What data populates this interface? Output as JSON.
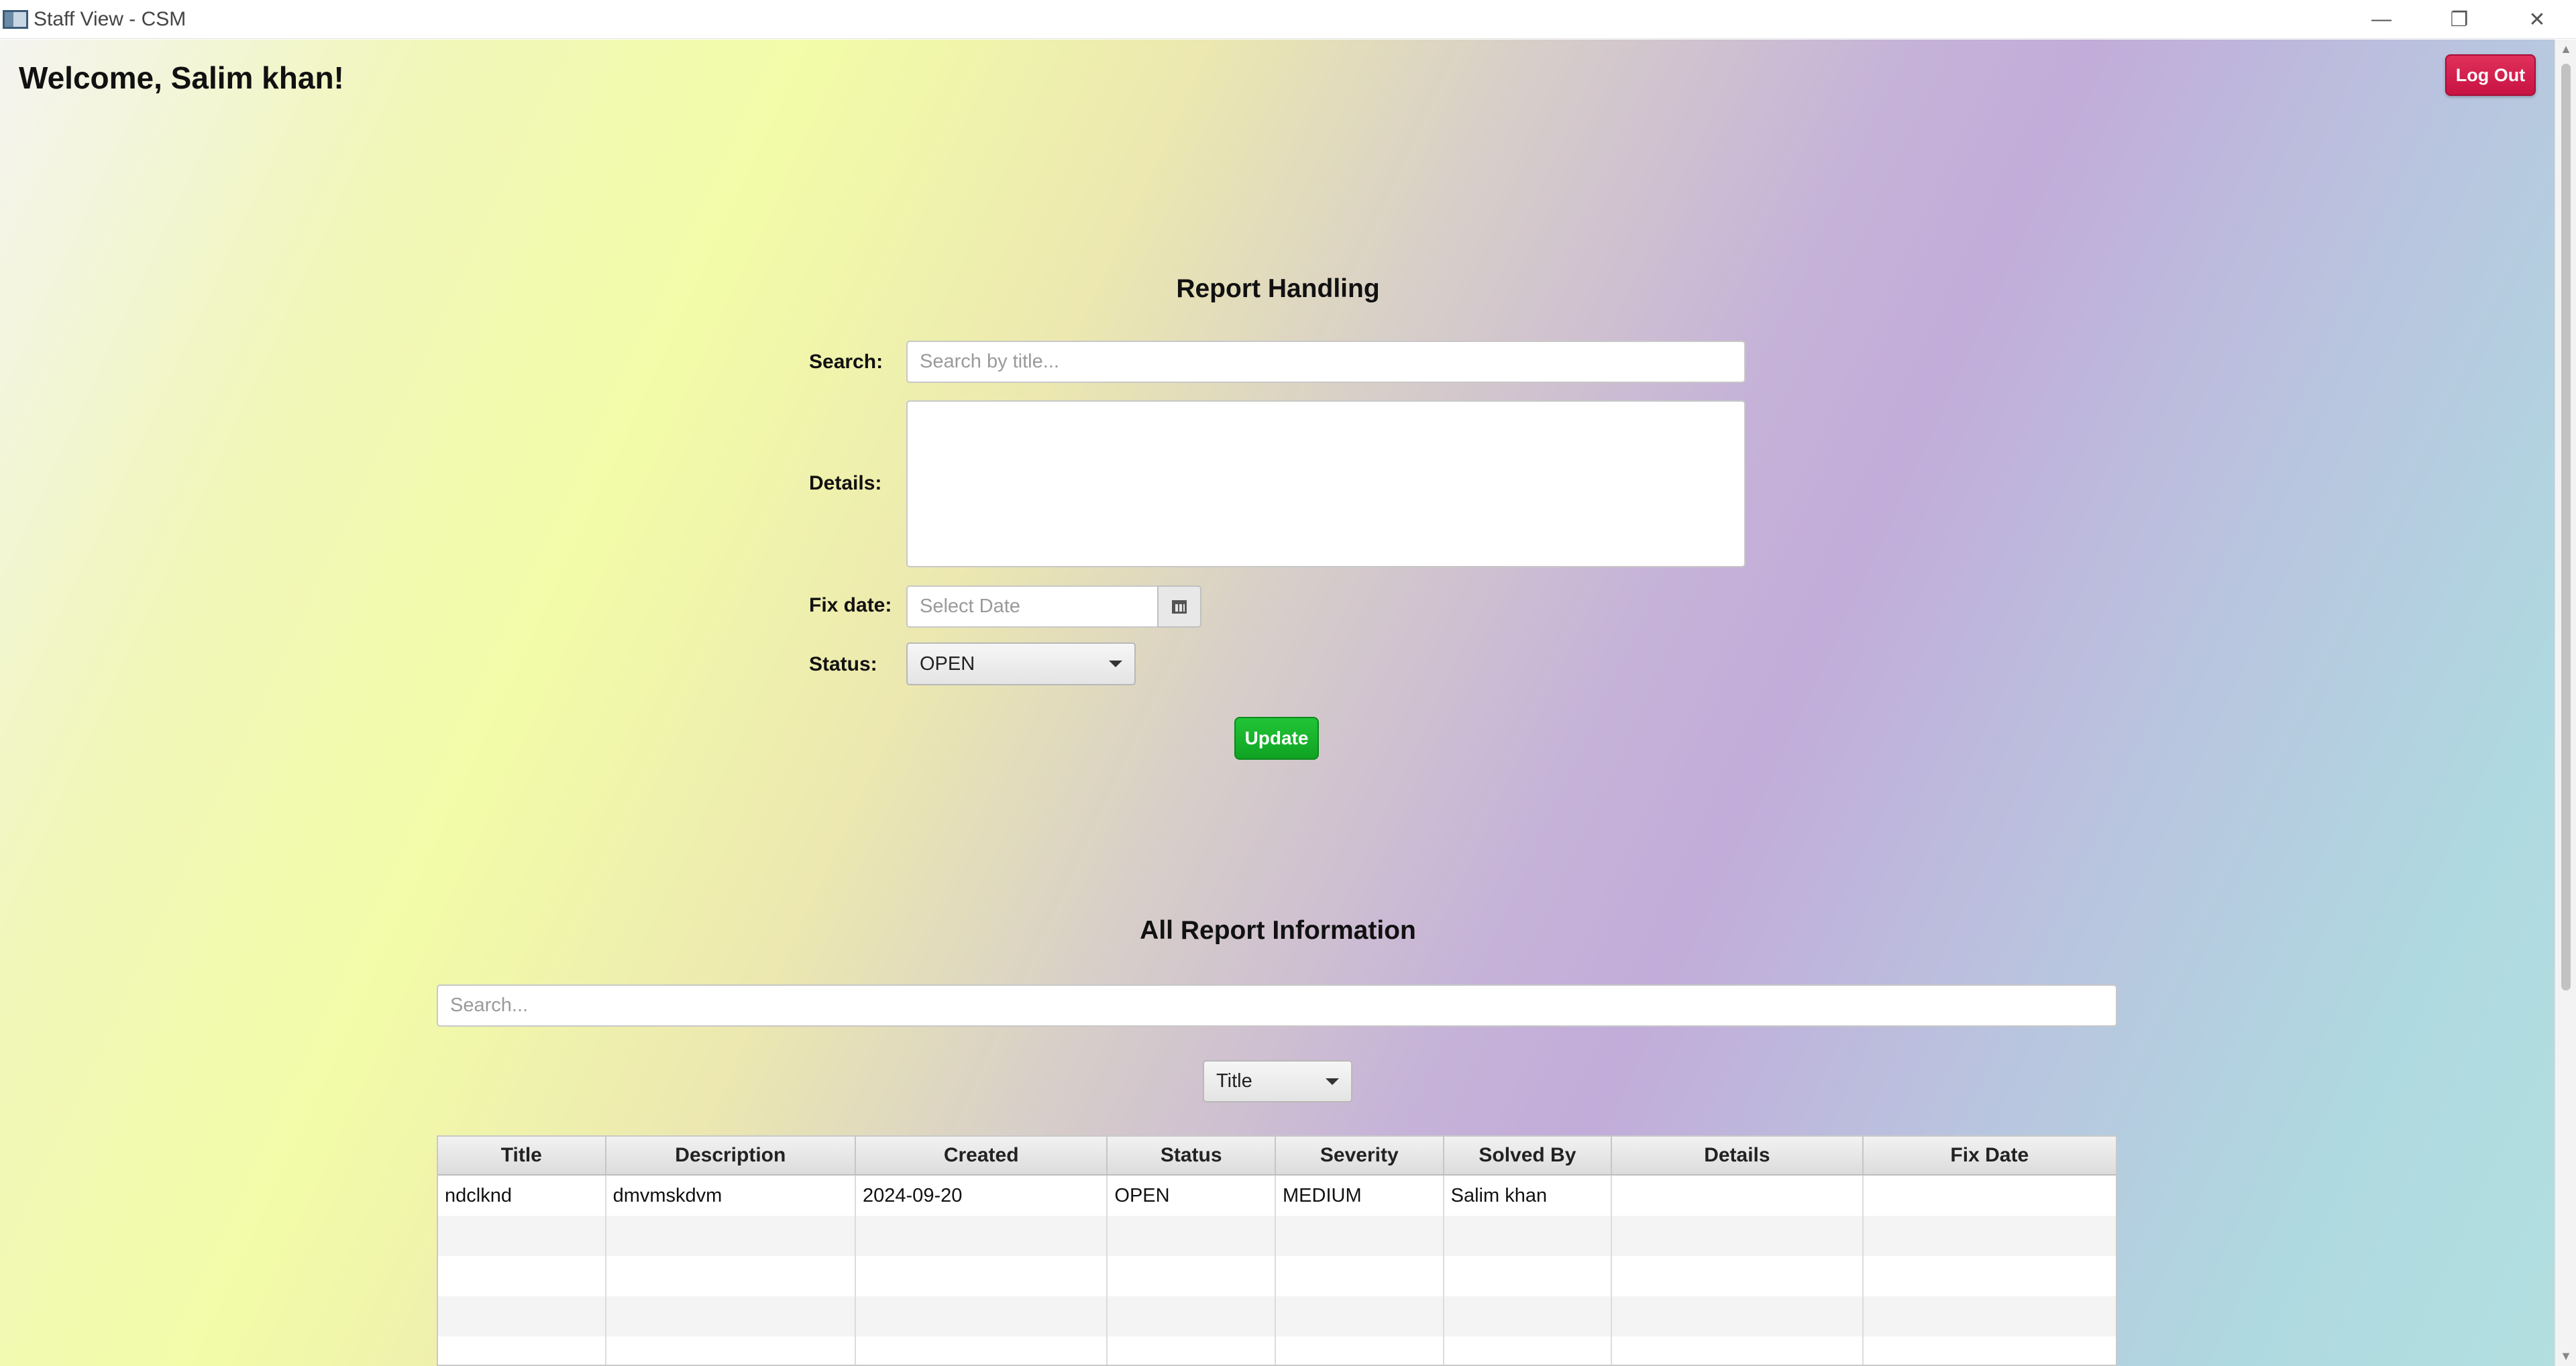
{
  "window": {
    "title": "Staff View - CSM",
    "minimize_glyph": "—",
    "maximize_glyph": "❐",
    "close_glyph": "✕"
  },
  "header": {
    "welcome": "Welcome, Salim khan!",
    "logout_label": "Log Out"
  },
  "report_handling": {
    "title": "Report Handling",
    "search_label": "Search:",
    "search_placeholder": "Search by title...",
    "details_label": "Details:",
    "details_value": "",
    "fix_date_label": "Fix date:",
    "fix_date_placeholder": "Select Date",
    "status_label": "Status:",
    "status_value": "OPEN",
    "update_label": "Update"
  },
  "all_reports": {
    "title": "All Report Information",
    "search_placeholder": "Search...",
    "filter_value": "Title",
    "columns": [
      "Title",
      "Description",
      "Created",
      "Status",
      "Severity",
      "Solved By",
      "Details",
      "Fix Date"
    ],
    "rows": [
      [
        "ndclknd",
        "dmvmskdvm",
        "2024-09-20",
        "OPEN",
        "MEDIUM",
        "Salim khan",
        "",
        ""
      ]
    ]
  },
  "colors": {
    "logout": "#d21e4c",
    "update": "#16b42a"
  }
}
